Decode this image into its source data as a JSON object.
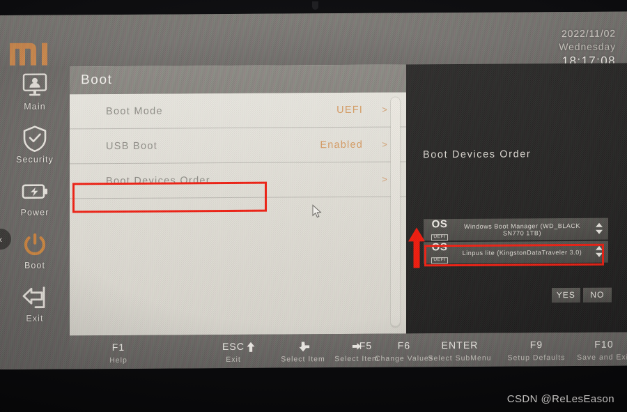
{
  "brand": {
    "logo": "mi-logo",
    "logo_color": "#d18a4e"
  },
  "clock": {
    "date": "2022/11/02",
    "weekday": "Wednesday",
    "time": "18:17:08"
  },
  "sidebar": {
    "collapse_glyph": "‹",
    "items": [
      {
        "label": "Main",
        "icon": "monitor-user-icon",
        "active": false
      },
      {
        "label": "Security",
        "icon": "shield-check-icon",
        "active": false
      },
      {
        "label": "Power",
        "icon": "battery-bolt-icon",
        "active": false
      },
      {
        "label": "Boot",
        "icon": "power-icon",
        "active": true
      },
      {
        "label": "Exit",
        "icon": "exit-arrow-icon",
        "active": false
      }
    ]
  },
  "panel": {
    "title": "Boot",
    "rows": [
      {
        "name": "Boot Mode",
        "value": "UEFI",
        "chevron": ">"
      },
      {
        "name": "USB Boot",
        "value": "Enabled",
        "chevron": ">"
      },
      {
        "name": "Boot Devices Order",
        "value": "",
        "chevron": ">"
      }
    ]
  },
  "detail": {
    "title": "Boot Devices Order",
    "devices": [
      {
        "badge": "OS",
        "tag": "UEFI",
        "name": "Windows Boot Manager (WD_BLACK SN770 1TB)",
        "sorter": "sort-updown-icon",
        "highlighted": false
      },
      {
        "badge": "OS",
        "tag": "UEFI",
        "name": "Linpus lite (KingstonDataTraveler 3.0)",
        "sorter": "sort-updown-icon",
        "highlighted": true
      }
    ],
    "confirm": {
      "yes": "YES",
      "no": "NO"
    }
  },
  "function_bar": {
    "keys": [
      {
        "key": "F1",
        "glyph": "",
        "desc": "Help"
      },
      {
        "key": "ESC",
        "glyph": "",
        "desc": "Exit"
      },
      {
        "key": "",
        "glyph": "arrow-up",
        "desc": ""
      },
      {
        "key": "",
        "glyph": "arrow-down",
        "desc": "Select Item"
      },
      {
        "key": "",
        "glyph": "arrow-left",
        "desc": ""
      },
      {
        "key": "",
        "glyph": "arrow-right",
        "desc": "Select Item"
      },
      {
        "key": "F5",
        "glyph": "",
        "desc": ""
      },
      {
        "key": "F6",
        "glyph": "",
        "desc": "Change Values"
      },
      {
        "key": "ENTER",
        "glyph": "",
        "desc": "Select  SubMenu"
      },
      {
        "key": "F9",
        "glyph": "",
        "desc": "Setup Defaults"
      },
      {
        "key": "F10",
        "glyph": "",
        "desc": "Save and Exit"
      }
    ]
  },
  "annotations": {
    "highlight_color": "#ee1f12",
    "arrow": "red-up-arrow"
  },
  "watermark": "CSDN @ReLesEason"
}
